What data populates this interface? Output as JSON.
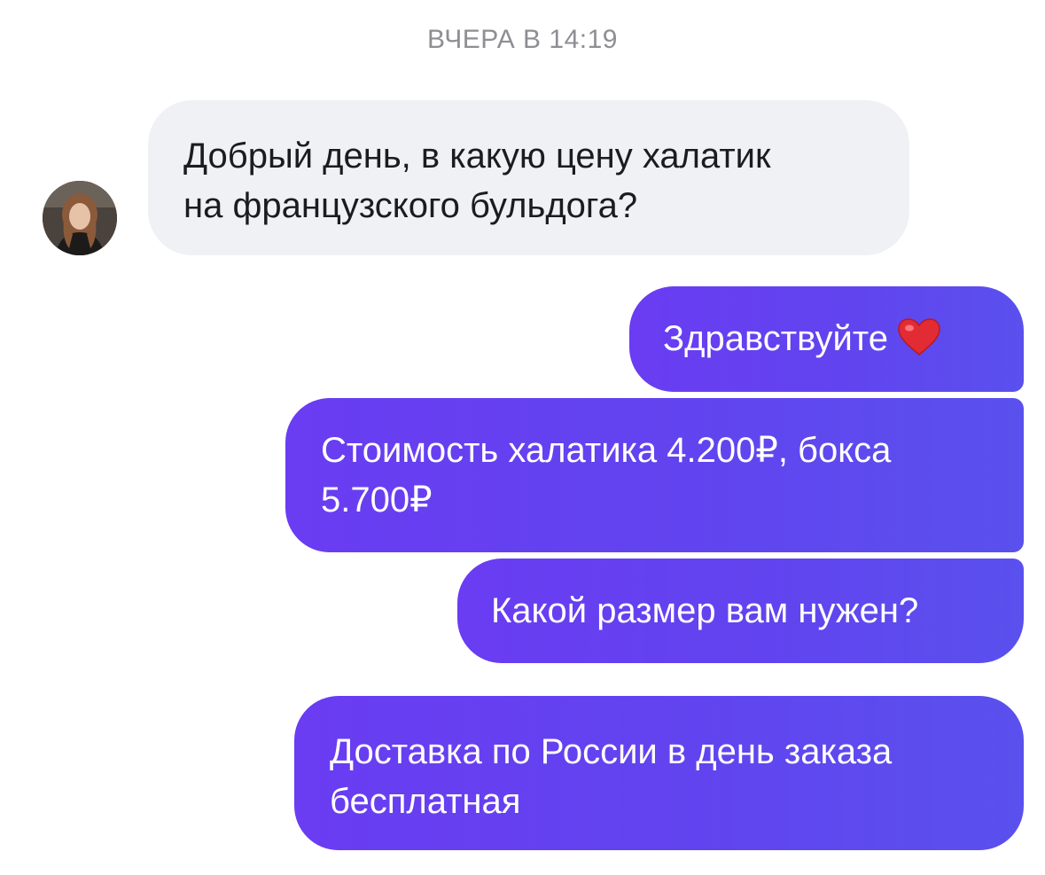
{
  "header": {
    "timestamp": "ВЧЕРА В 14:19"
  },
  "messages": [
    {
      "direction": "incoming",
      "lines": [
        "Добрый день, в какую цену халатик",
        "на французского бульдога?"
      ]
    },
    {
      "direction": "outgoing",
      "lines": [
        "Здравствуйте"
      ],
      "emoji": "heart-emoji"
    },
    {
      "direction": "outgoing",
      "lines": [
        "Стоимость халатика 4.200₽, бокса",
        "5.700₽"
      ]
    },
    {
      "direction": "outgoing",
      "lines": [
        "Какой размер вам нужен?"
      ]
    },
    {
      "direction": "outgoing",
      "lines": [
        "Доставка по России в день заказа",
        "бесплатная"
      ]
    }
  ],
  "colors": {
    "incoming_bubble": "#eff1f5",
    "outgoing_bubble_start": "#6a3cf2",
    "outgoing_bubble_end": "#5a50ee",
    "timestamp_text": "#8e8e93"
  }
}
